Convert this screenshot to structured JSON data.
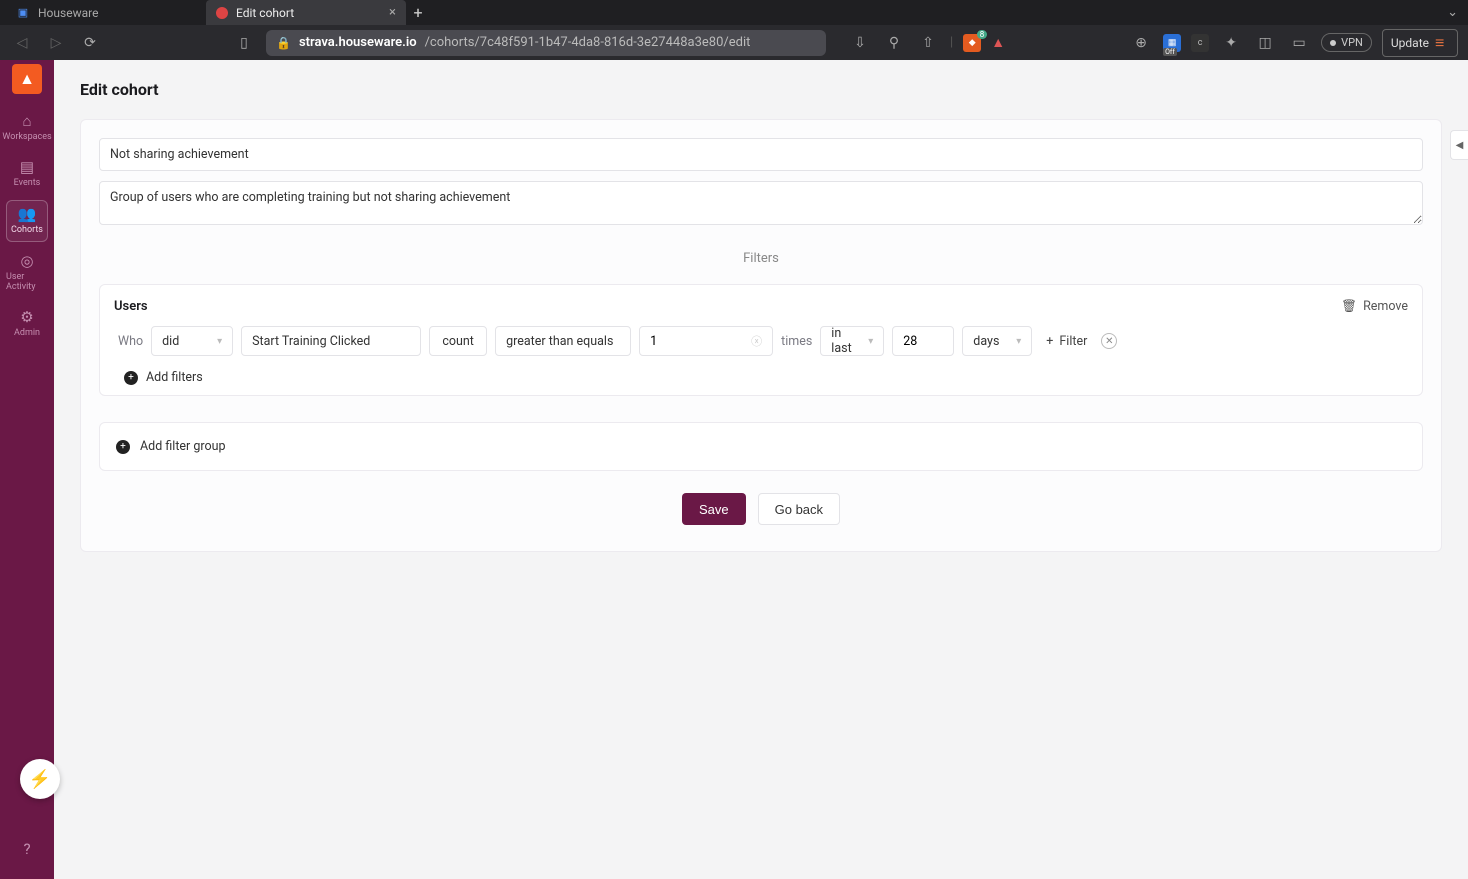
{
  "browser": {
    "tabs": [
      {
        "title": "Houseware",
        "active": false
      },
      {
        "title": "Edit cohort",
        "active": true
      }
    ],
    "url_host": "strava.houseware.io",
    "url_path": "/cohorts/7c48f591-1b47-4da8-816d-3e27448a3e80/edit",
    "vpn_label": "VPN",
    "update_label": "Update"
  },
  "sidebar": {
    "items": [
      {
        "id": "workspaces",
        "label": "Workspaces",
        "icon": "⌂"
      },
      {
        "id": "events",
        "label": "Events",
        "icon": "▤"
      },
      {
        "id": "cohorts",
        "label": "Cohorts",
        "icon": "👥",
        "active": true
      },
      {
        "id": "user-activity",
        "label": "User Activity",
        "icon": "◎"
      },
      {
        "id": "admin",
        "label": "Admin",
        "icon": "⚙"
      }
    ],
    "help_icon": "?"
  },
  "page": {
    "title": "Edit cohort",
    "name_value": "Not sharing achievement",
    "description_value": "Group of users who are completing training but not sharing achievement",
    "filters_label": "Filters",
    "group_title": "Users",
    "remove_label": "Remove",
    "row": {
      "who_label": "Who",
      "did": "did",
      "event": "Start Training Clicked",
      "count_label": "count",
      "op": "greater than equals",
      "value": "1",
      "times_label": "times",
      "in_last": "in last",
      "period_value": "28",
      "period_unit": "days",
      "filter_btn": "Filter"
    },
    "add_filters_label": "Add filters",
    "add_group_label": "Add filter group",
    "save_label": "Save",
    "back_label": "Go back"
  }
}
